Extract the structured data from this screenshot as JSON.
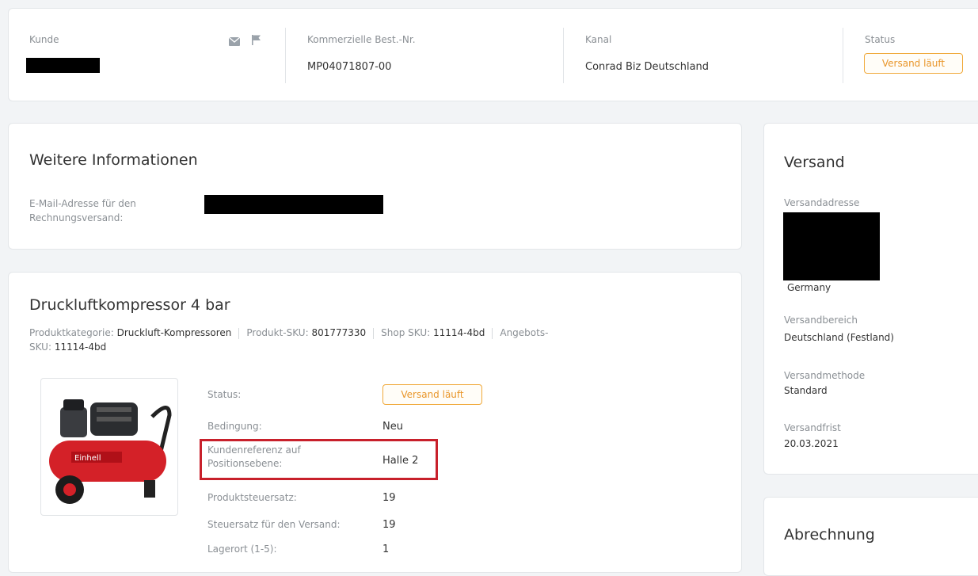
{
  "header": {
    "kunde_label": "Kunde",
    "bestnr_label": "Kommerzielle Best.-Nr.",
    "bestnr_value": "MP04071807-00",
    "kanal_label": "Kanal",
    "kanal_value": "Conrad Biz Deutschland",
    "status_label": "Status",
    "status_value": "Versand läuft",
    "icons": [
      "mail-icon",
      "flag-icon"
    ]
  },
  "weitere": {
    "title": "Weitere Informationen",
    "email_label_line1": "E-Mail-Adresse für den",
    "email_label_line2": "Rechnungsversand:"
  },
  "product": {
    "title": "Druckluftkompressor 4 bar",
    "kategorie_label": "Produktkategorie:",
    "kategorie_value": "Druckluft-Kompressoren",
    "sku_label": "Produkt-SKU:",
    "sku_value": "801777330",
    "shop_sku_label": "Shop SKU:",
    "shop_sku_value": "11114-4bd",
    "angebots_label_1": "Angebots-",
    "angebots_label_2": "SKU:",
    "angebots_value": "11114-4bd",
    "image_brand": "Einhell",
    "details": {
      "status_label": "Status:",
      "status_value": "Versand läuft",
      "bedingung_label": "Bedingung:",
      "bedingung_value": "Neu",
      "kundenref_label_1": "Kundenreferenz auf",
      "kundenref_label_2": "Positionsebene:",
      "kundenref_value": "Halle 2",
      "steuersatz_label": "Produktsteuersatz:",
      "steuersatz_value": "19",
      "versandsteuer_label": "Steuersatz für den Versand:",
      "versandsteuer_value": "19",
      "lagerort_label": "Lagerort (1-5):",
      "lagerort_value": "1"
    }
  },
  "versand": {
    "title": "Versand",
    "adresse_label": "Versandadresse",
    "country": "Germany",
    "bereich_label": "Versandbereich",
    "bereich_value": "Deutschland (Festland)",
    "methode_label": "Versandmethode",
    "methode_value": "Standard",
    "frist_label": "Versandfrist",
    "frist_value": "20.03.2021"
  },
  "abrechnung": {
    "title": "Abrechnung"
  },
  "colors": {
    "badge": "#e9962a",
    "highlight": "#c8202b",
    "background": "#f2f4f6"
  }
}
